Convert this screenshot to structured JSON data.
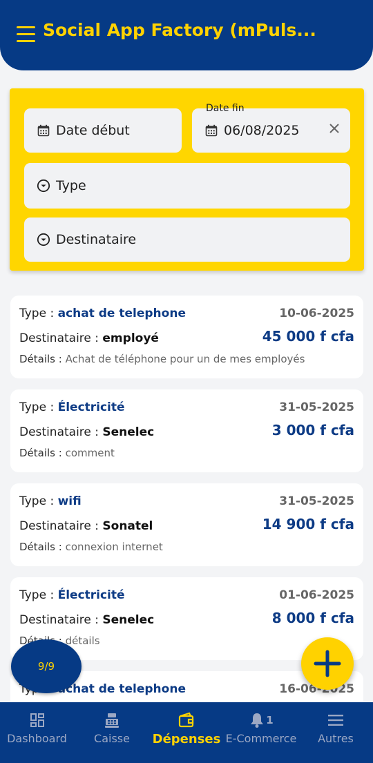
{
  "header": {
    "title": "Social App Factory (mPuls...",
    "menu_icon": "hamburger-menu-icon"
  },
  "filters": {
    "start_date_placeholder": "Date début",
    "end_date_label": "Date fin",
    "end_date_value": "06/08/2025",
    "type_placeholder": "Type",
    "recipient_placeholder": "Destinataire"
  },
  "labels": {
    "type": "Type : ",
    "recipient": "Destinataire : ",
    "details": "Détails : "
  },
  "expenses": [
    {
      "type": "achat de telephone",
      "recipient": "employé",
      "details": "Achat de téléphone pour un de mes employés",
      "date": "10-06-2025",
      "amount": "45 000 f cfa"
    },
    {
      "type": "Électricité",
      "recipient": "Senelec",
      "details": "comment",
      "date": "31-05-2025",
      "amount": "3 000 f cfa"
    },
    {
      "type": "wifi",
      "recipient": "Sonatel",
      "details": "connexion internet",
      "date": "31-05-2025",
      "amount": "14 900 f cfa"
    },
    {
      "type": "Électricité",
      "recipient": "Senelec",
      "details": "détails",
      "date": "01-06-2025",
      "amount": "8 000 f cfa"
    },
    {
      "type": "achat de telephone",
      "recipient": "",
      "details": "",
      "date": "16-06-2025",
      "amount": ""
    }
  ],
  "counter": "9/9",
  "nav": {
    "dashboard": "Dashboard",
    "caisse": "Caisse",
    "depenses": "Dépenses",
    "ecommerce": "E-Commerce",
    "ecommerce_badge": "1",
    "autres": "Autres"
  },
  "colors": {
    "primary": "#063a85",
    "accent": "#ffd200",
    "filter_bg": "#ffd600"
  }
}
